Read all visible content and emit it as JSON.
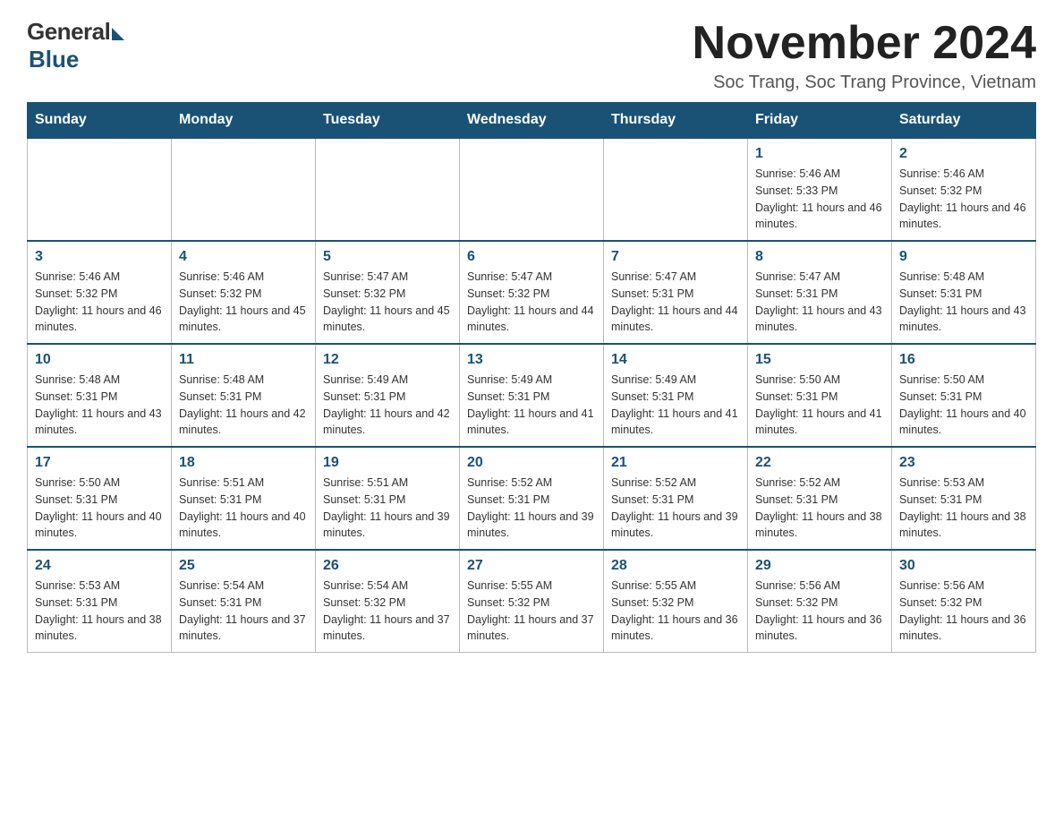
{
  "logo": {
    "general": "General",
    "blue": "Blue"
  },
  "title": "November 2024",
  "subtitle": "Soc Trang, Soc Trang Province, Vietnam",
  "days_of_week": [
    "Sunday",
    "Monday",
    "Tuesday",
    "Wednesday",
    "Thursday",
    "Friday",
    "Saturday"
  ],
  "weeks": [
    [
      {
        "day": "",
        "info": ""
      },
      {
        "day": "",
        "info": ""
      },
      {
        "day": "",
        "info": ""
      },
      {
        "day": "",
        "info": ""
      },
      {
        "day": "",
        "info": ""
      },
      {
        "day": "1",
        "info": "Sunrise: 5:46 AM\nSunset: 5:33 PM\nDaylight: 11 hours and 46 minutes."
      },
      {
        "day": "2",
        "info": "Sunrise: 5:46 AM\nSunset: 5:32 PM\nDaylight: 11 hours and 46 minutes."
      }
    ],
    [
      {
        "day": "3",
        "info": "Sunrise: 5:46 AM\nSunset: 5:32 PM\nDaylight: 11 hours and 46 minutes."
      },
      {
        "day": "4",
        "info": "Sunrise: 5:46 AM\nSunset: 5:32 PM\nDaylight: 11 hours and 45 minutes."
      },
      {
        "day": "5",
        "info": "Sunrise: 5:47 AM\nSunset: 5:32 PM\nDaylight: 11 hours and 45 minutes."
      },
      {
        "day": "6",
        "info": "Sunrise: 5:47 AM\nSunset: 5:32 PM\nDaylight: 11 hours and 44 minutes."
      },
      {
        "day": "7",
        "info": "Sunrise: 5:47 AM\nSunset: 5:31 PM\nDaylight: 11 hours and 44 minutes."
      },
      {
        "day": "8",
        "info": "Sunrise: 5:47 AM\nSunset: 5:31 PM\nDaylight: 11 hours and 43 minutes."
      },
      {
        "day": "9",
        "info": "Sunrise: 5:48 AM\nSunset: 5:31 PM\nDaylight: 11 hours and 43 minutes."
      }
    ],
    [
      {
        "day": "10",
        "info": "Sunrise: 5:48 AM\nSunset: 5:31 PM\nDaylight: 11 hours and 43 minutes."
      },
      {
        "day": "11",
        "info": "Sunrise: 5:48 AM\nSunset: 5:31 PM\nDaylight: 11 hours and 42 minutes."
      },
      {
        "day": "12",
        "info": "Sunrise: 5:49 AM\nSunset: 5:31 PM\nDaylight: 11 hours and 42 minutes."
      },
      {
        "day": "13",
        "info": "Sunrise: 5:49 AM\nSunset: 5:31 PM\nDaylight: 11 hours and 41 minutes."
      },
      {
        "day": "14",
        "info": "Sunrise: 5:49 AM\nSunset: 5:31 PM\nDaylight: 11 hours and 41 minutes."
      },
      {
        "day": "15",
        "info": "Sunrise: 5:50 AM\nSunset: 5:31 PM\nDaylight: 11 hours and 41 minutes."
      },
      {
        "day": "16",
        "info": "Sunrise: 5:50 AM\nSunset: 5:31 PM\nDaylight: 11 hours and 40 minutes."
      }
    ],
    [
      {
        "day": "17",
        "info": "Sunrise: 5:50 AM\nSunset: 5:31 PM\nDaylight: 11 hours and 40 minutes."
      },
      {
        "day": "18",
        "info": "Sunrise: 5:51 AM\nSunset: 5:31 PM\nDaylight: 11 hours and 40 minutes."
      },
      {
        "day": "19",
        "info": "Sunrise: 5:51 AM\nSunset: 5:31 PM\nDaylight: 11 hours and 39 minutes."
      },
      {
        "day": "20",
        "info": "Sunrise: 5:52 AM\nSunset: 5:31 PM\nDaylight: 11 hours and 39 minutes."
      },
      {
        "day": "21",
        "info": "Sunrise: 5:52 AM\nSunset: 5:31 PM\nDaylight: 11 hours and 39 minutes."
      },
      {
        "day": "22",
        "info": "Sunrise: 5:52 AM\nSunset: 5:31 PM\nDaylight: 11 hours and 38 minutes."
      },
      {
        "day": "23",
        "info": "Sunrise: 5:53 AM\nSunset: 5:31 PM\nDaylight: 11 hours and 38 minutes."
      }
    ],
    [
      {
        "day": "24",
        "info": "Sunrise: 5:53 AM\nSunset: 5:31 PM\nDaylight: 11 hours and 38 minutes."
      },
      {
        "day": "25",
        "info": "Sunrise: 5:54 AM\nSunset: 5:31 PM\nDaylight: 11 hours and 37 minutes."
      },
      {
        "day": "26",
        "info": "Sunrise: 5:54 AM\nSunset: 5:32 PM\nDaylight: 11 hours and 37 minutes."
      },
      {
        "day": "27",
        "info": "Sunrise: 5:55 AM\nSunset: 5:32 PM\nDaylight: 11 hours and 37 minutes."
      },
      {
        "day": "28",
        "info": "Sunrise: 5:55 AM\nSunset: 5:32 PM\nDaylight: 11 hours and 36 minutes."
      },
      {
        "day": "29",
        "info": "Sunrise: 5:56 AM\nSunset: 5:32 PM\nDaylight: 11 hours and 36 minutes."
      },
      {
        "day": "30",
        "info": "Sunrise: 5:56 AM\nSunset: 5:32 PM\nDaylight: 11 hours and 36 minutes."
      }
    ]
  ]
}
